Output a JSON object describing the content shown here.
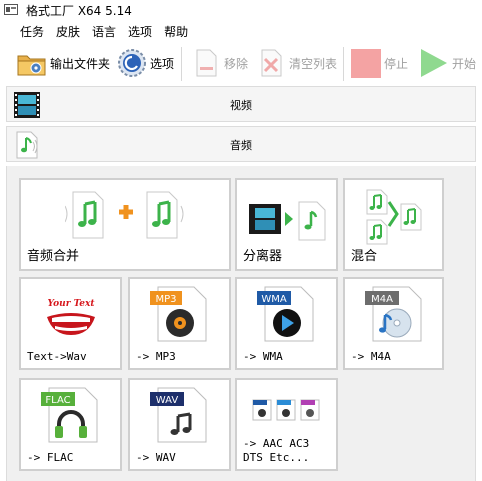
{
  "window": {
    "title": "格式工厂 X64 5.14"
  },
  "menu": [
    "任务",
    "皮肤",
    "语言",
    "选项",
    "帮助"
  ],
  "toolbar": {
    "output_folder": "输出文件夹",
    "options": "选项",
    "remove": "移除",
    "clear_list": "清空列表",
    "stop": "停止",
    "start": "开始"
  },
  "categories": {
    "video": "视频",
    "audio": "音频"
  },
  "tiles": {
    "audio_merge": "音频合并",
    "splitter": "分离器",
    "mix": "混合",
    "text_to_wav": "Text->Wav",
    "to_mp3": "-> MP3",
    "to_wma": "-> WMA",
    "to_m4a": "-> M4A",
    "to_flac": "-> FLAC",
    "to_wav": "-> WAV",
    "to_other": "-> AAC AC3\nDTS Etc..."
  },
  "badges": {
    "mp3": "MP3",
    "wma": "WMA",
    "m4a": "M4A",
    "flac": "FLAC",
    "wav": "WAV",
    "text_logo": "Your Text"
  },
  "colors": {
    "accent_green": "#3cb34a",
    "stop_red": "#f4a3a3",
    "start_green": "#8fd98f",
    "mp3_orange": "#f0921e",
    "wma_blue": "#1f5aa6",
    "m4a_gray": "#6d6d6d",
    "flac_green": "#57b03b",
    "wav_navy": "#1d2f6b"
  }
}
